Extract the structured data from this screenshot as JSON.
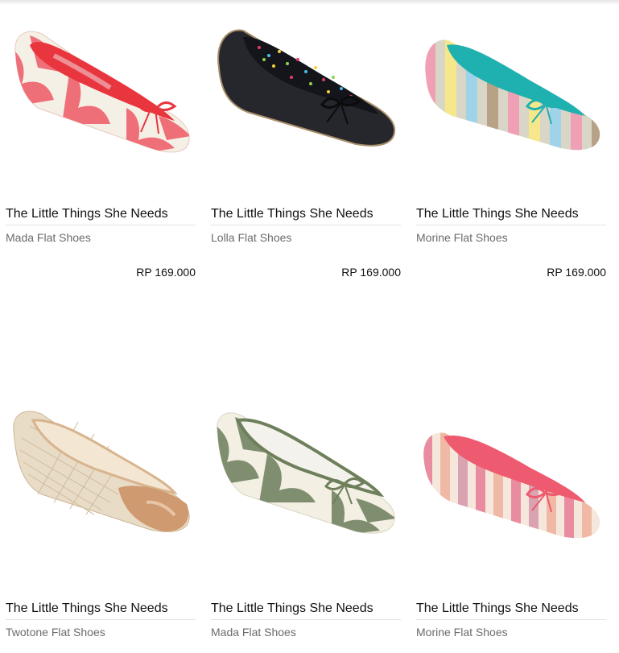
{
  "products": [
    {
      "brand": "The Little Things She Needs",
      "name": "Mada Flat Shoes",
      "price": "RP 169.000",
      "image": "coral-ikat-flat-icon",
      "colors": {
        "outer": "#ef6f78",
        "lining": "#e8353e",
        "accent": "#f5f0e6"
      }
    },
    {
      "brand": "The Little Things She Needs",
      "name": "Lolla Flat Shoes",
      "price": "RP 169.000",
      "image": "black-polka-dot-flat-icon",
      "colors": {
        "outer": "#25272d",
        "lining": "#1a1a1f",
        "accent": "#e33b6b"
      }
    },
    {
      "brand": "The Little Things She Needs",
      "name": "Morine Flat Shoes",
      "price": "RP 169.000",
      "image": "teal-striped-flat-icon",
      "colors": {
        "outer": "#d9d6c8",
        "lining": "#1fb0b0",
        "accent": "#f0a0b4"
      }
    },
    {
      "brand": "The Little Things She Needs",
      "name": "Twotone Flat Shoes",
      "price": "",
      "image": "beige-twotone-flat-icon",
      "colors": {
        "outer": "#e9dcc7",
        "lining": "#d8b48e",
        "accent": "#cf9a6f"
      }
    },
    {
      "brand": "The Little Things She Needs",
      "name": "Mada Flat Shoes",
      "price": "",
      "image": "green-ikat-flat-icon",
      "colors": {
        "outer": "#7f8e6f",
        "lining": "#6e7f5b",
        "accent": "#f3efe3"
      }
    },
    {
      "brand": "The Little Things She Needs",
      "name": "Morine Flat Shoes",
      "price": "",
      "image": "pink-striped-flat-icon",
      "colors": {
        "outer": "#f0b9a6",
        "lining": "#ee5a6f",
        "accent": "#e98ca0"
      }
    }
  ]
}
